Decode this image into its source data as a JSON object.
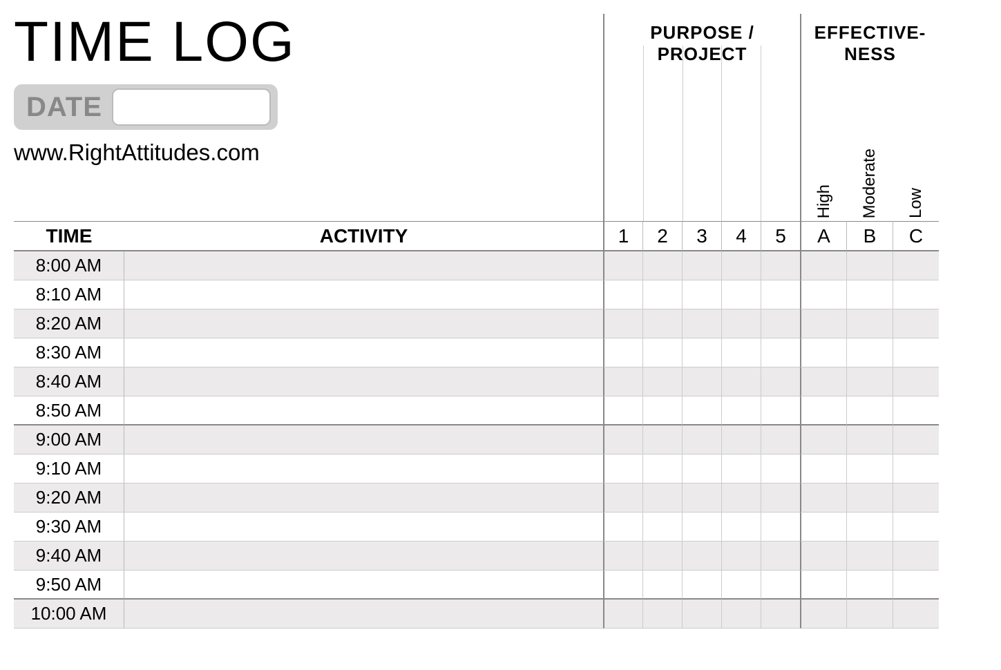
{
  "title": "TIME LOG",
  "date_label": "DATE",
  "date_value": "",
  "website": "www.RightAttitudes.com",
  "headers": {
    "time": "TIME",
    "activity": "ACTIVITY",
    "purpose_group": "PURPOSE / PROJECT",
    "effectiveness_group": "EFFECTIVE-\nNESS",
    "purpose_cols": [
      "1",
      "2",
      "3",
      "4",
      "5"
    ],
    "effectiveness_cols": [
      "A",
      "B",
      "C"
    ],
    "effectiveness_labels": [
      "High",
      "Moderate",
      "Low"
    ]
  },
  "rows": [
    {
      "time": "8:00 AM",
      "shade": true,
      "hourstart": true
    },
    {
      "time": "8:10 AM",
      "shade": false
    },
    {
      "time": "8:20 AM",
      "shade": true
    },
    {
      "time": "8:30 AM",
      "shade": false
    },
    {
      "time": "8:40 AM",
      "shade": true
    },
    {
      "time": "8:50 AM",
      "shade": false,
      "hoursep": true
    },
    {
      "time": "9:00 AM",
      "shade": true
    },
    {
      "time": "9:10 AM",
      "shade": false
    },
    {
      "time": "9:20 AM",
      "shade": true
    },
    {
      "time": "9:30 AM",
      "shade": false
    },
    {
      "time": "9:40 AM",
      "shade": true
    },
    {
      "time": "9:50 AM",
      "shade": false,
      "hoursep": true
    },
    {
      "time": "10:00 AM",
      "shade": true
    }
  ]
}
